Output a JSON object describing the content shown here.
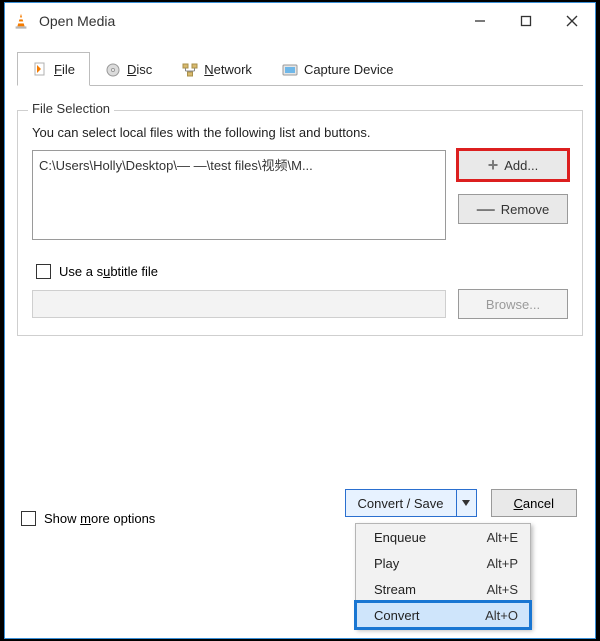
{
  "window": {
    "title": "Open Media"
  },
  "tabs": {
    "file_prefix": "F",
    "file_rest": "ile",
    "disc_prefix": "D",
    "disc_rest": "isc",
    "network_prefix": "N",
    "network_rest": "etwork",
    "capture": "Capture Device"
  },
  "fileSelection": {
    "legend": "File Selection",
    "instruction": "You can select local files with the following list and buttons.",
    "path": "C:\\Users\\Holly\\Desktop\\— —\\test files\\视频\\M...",
    "add": "Add...",
    "remove": "Remove"
  },
  "subtitle": {
    "label_pre": "Use a s",
    "label_u": "u",
    "label_post": "btitle file",
    "browse": "Browse..."
  },
  "more": {
    "label_pre": "Show ",
    "label_u": "m",
    "label_post": "ore options"
  },
  "bottom": {
    "convert_save": "Convert / Save",
    "cancel_u": "C",
    "cancel_rest": "ancel"
  },
  "menu": {
    "items": [
      {
        "label": "Enqueue",
        "accel": "Alt+E"
      },
      {
        "label": "Play",
        "accel": "Alt+P"
      },
      {
        "label": "Stream",
        "accel": "Alt+S"
      },
      {
        "label": "Convert",
        "accel": "Alt+O"
      }
    ]
  }
}
